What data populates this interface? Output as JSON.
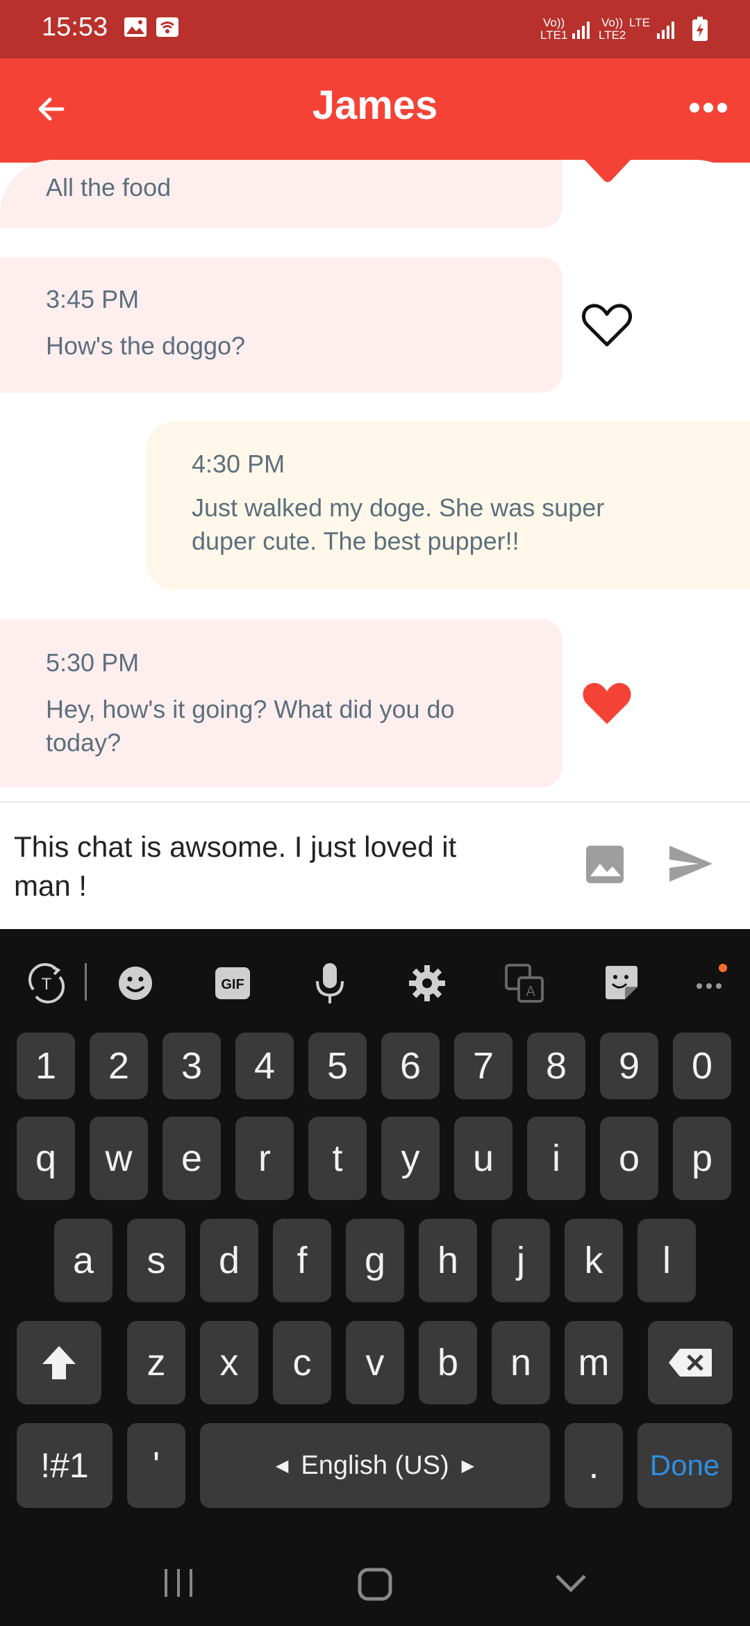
{
  "status_bar": {
    "time": "15:53",
    "sim1_label_top": "Vo))",
    "sim1_label_bottom": "LTE1",
    "sim2_label_top": "Vo))",
    "sim2_label_bottom": "LTE2",
    "lte_label": "LTE",
    "icons": [
      "gallery-icon",
      "wifi-icon",
      "signal-icon",
      "battery-charging-icon"
    ]
  },
  "header": {
    "title": "James",
    "back_icon": "arrow-left-icon",
    "more_icon": "more-horizontal-icon"
  },
  "messages": [
    {
      "sender": "other",
      "time": "",
      "text": "All the food"
    },
    {
      "sender": "other",
      "time": "3:45 PM",
      "text": "How's the doggo?",
      "liked": false
    },
    {
      "sender": "me",
      "time": "4:30 PM",
      "text_line1": "Just walked my doge. She was super",
      "text_line2": "duper cute. The best pupper!!"
    },
    {
      "sender": "other",
      "time": "5:30 PM",
      "text_line1": "Hey, how's it going? What did you do",
      "text_line2": "today?",
      "liked": true
    }
  ],
  "composer": {
    "text_line1": "This chat is awsome. I just loved it",
    "text_line2": "man !",
    "image_icon": "image-icon",
    "send_icon": "send-icon"
  },
  "keyboard": {
    "toolbar": [
      "translate-icon",
      "emoji-icon",
      "gif-icon",
      "mic-icon",
      "settings-icon",
      "translate-screen-icon",
      "sticker-icon",
      "more-icon"
    ],
    "gif_label": "GIF",
    "number_row": [
      "1",
      "2",
      "3",
      "4",
      "5",
      "6",
      "7",
      "8",
      "9",
      "0"
    ],
    "row1": [
      "q",
      "w",
      "e",
      "r",
      "t",
      "y",
      "u",
      "i",
      "o",
      "p"
    ],
    "row2": [
      "a",
      "s",
      "d",
      "f",
      "g",
      "h",
      "j",
      "k",
      "l"
    ],
    "row3": [
      "z",
      "x",
      "c",
      "v",
      "b",
      "n",
      "m"
    ],
    "symbols_label": "!#1",
    "apostrophe_label": "'",
    "space_label": "English (US)",
    "period_label": ".",
    "done_label": "Done",
    "colors": {
      "key": "#3a3a3a",
      "background": "#111111",
      "done": "#2f8ee0"
    }
  },
  "nav_bar": [
    "recents-icon",
    "home-icon",
    "back-chevron-icon"
  ],
  "colors": {
    "header": "#f44336",
    "status_bar": "#b8312c",
    "incoming_bubble": "#ffeeee",
    "outgoing_bubble": "#fff8ea",
    "message_text": "#5b6f7d",
    "heart": "#f44336"
  }
}
